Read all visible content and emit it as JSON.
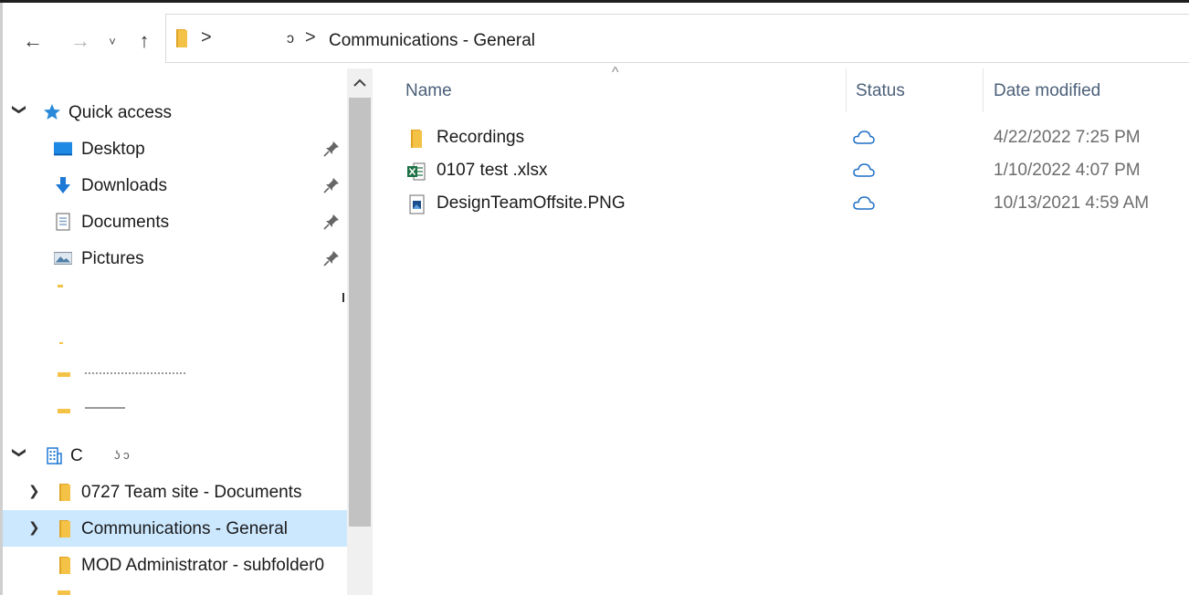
{
  "navigation": {
    "back_icon": "arrow-left-icon",
    "forward_icon": "arrow-right-icon",
    "recent_icon": "chevron-down-icon",
    "up_icon": "arrow-up-icon",
    "back_glyph": "←",
    "forward_glyph": "→",
    "recent_glyph": "˅",
    "up_glyph": "↑"
  },
  "address": {
    "separator": ">",
    "fragment": "ɔ",
    "current": "Communications - General"
  },
  "nav_pane": {
    "quick_access": {
      "label": "Quick access",
      "items": [
        {
          "label": "Desktop",
          "icon": "desktop-icon"
        },
        {
          "label": "Downloads",
          "icon": "downloads-icon"
        },
        {
          "label": "Documents",
          "icon": "documents-icon"
        },
        {
          "label": "Pictures",
          "icon": "pictures-icon"
        }
      ]
    },
    "org": {
      "label": "C",
      "label_fragment": "ʖ ɔ",
      "items": [
        {
          "label": "0727 Team site - Documents",
          "selected": false,
          "expandable": true
        },
        {
          "label": "Communications - General",
          "selected": true,
          "expandable": true
        },
        {
          "label": "MOD Administrator - subfolder0",
          "selected": false,
          "expandable": false
        }
      ]
    },
    "expand_glyph": "❯",
    "collapse_glyph": "❯"
  },
  "columns": {
    "name": "Name",
    "status": "Status",
    "date_modified": "Date modified",
    "sort_caret": "^"
  },
  "files": [
    {
      "name": "Recordings",
      "type": "folder",
      "status_icon": "cloud-icon",
      "date": "4/22/2022 7:25 PM"
    },
    {
      "name": "0107 test .xlsx",
      "type": "excel",
      "status_icon": "cloud-icon",
      "date": "1/10/2022 4:07 PM"
    },
    {
      "name": "DesignTeamOffsite.PNG",
      "type": "image",
      "status_icon": "cloud-icon",
      "date": "10/13/2021 4:59 AM"
    }
  ],
  "colors": {
    "selected_row": "#cce8ff",
    "folder": "#f4c246",
    "folder_dark": "#e0a526",
    "excel_green": "#1e7145",
    "cloud_blue": "#1f6fc5",
    "header_text": "#4c607a"
  }
}
